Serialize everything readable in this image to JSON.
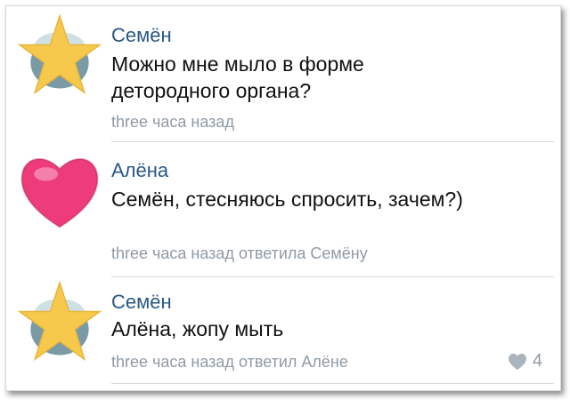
{
  "comments": [
    {
      "author": "Семён",
      "text": "Можно мне мыло в форме детородного органа?",
      "time": "three часа назад",
      "reply_to": "",
      "avatar_icon": "star-avatar"
    },
    {
      "author": "Алёна",
      "text": "Семён, стесняюсь спросить, зачем?)",
      "time": "three часа назад",
      "reply_to": "ответила Семёну",
      "avatar_icon": "heart-avatar"
    },
    {
      "author": "Семён",
      "text": "Алёна, жопу мыть",
      "time": "three часа назад",
      "reply_to": "ответил Алёне",
      "avatar_icon": "star-avatar",
      "likes": "4"
    }
  ],
  "colors": {
    "author": "#2a5885",
    "meta": "#8f9aa6",
    "star": "#f6c94c",
    "heart": "#ee3b7a"
  }
}
